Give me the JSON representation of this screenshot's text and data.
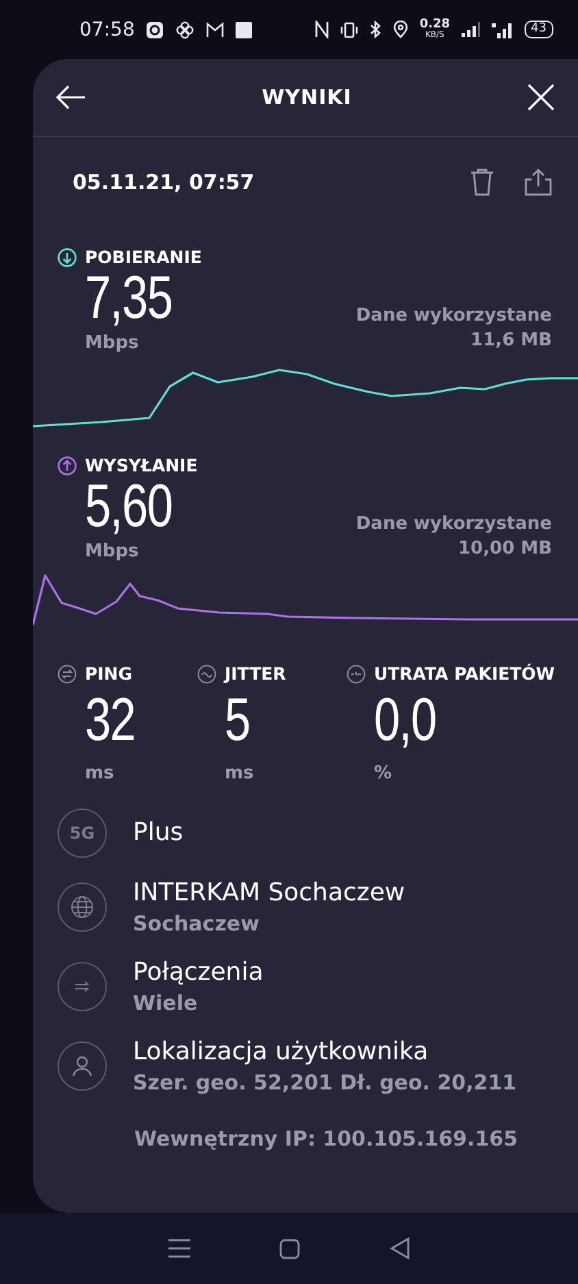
{
  "status_bar": {
    "time": "07:58",
    "network_speed": "0.28",
    "network_speed_unit": "KB/S",
    "battery": "43"
  },
  "header": {
    "title": "WYNIKI"
  },
  "result": {
    "date": "05.11.21, 07:57"
  },
  "speeds": [
    {
      "kind": "download",
      "label": "POBIERANIE",
      "value": "7,35",
      "unit": "Mbps",
      "data_label": "Dane wykorzystane",
      "data_value": "11,6 MB",
      "color": "#5ee0d8"
    },
    {
      "kind": "upload",
      "label": "WYSYŁANIE",
      "value": "5,60",
      "unit": "Mbps",
      "data_label": "Dane wykorzystane",
      "data_value": "10,00 MB",
      "color": "#b070e8"
    }
  ],
  "metrics": [
    {
      "kind": "ping",
      "label": "PING",
      "value": "32",
      "unit": "ms"
    },
    {
      "kind": "jitter",
      "label": "JITTER",
      "value": "5",
      "unit": "ms"
    },
    {
      "kind": "loss",
      "label": "UTRATA PAKIETÓW",
      "value": "0,0",
      "unit": "%"
    }
  ],
  "details": [
    {
      "kind": "network",
      "badge": "5G",
      "title": "Plus"
    },
    {
      "kind": "server",
      "title": "INTERKAM Sochaczew",
      "subtitle": "Sochaczew"
    },
    {
      "kind": "connections",
      "title": "Połączenia",
      "subtitle": "Wiele"
    },
    {
      "kind": "location",
      "title": "Lokalizacja użytkownika",
      "subtitle": "Szer. geo. 52,201 Dł. geo. 20,211"
    }
  ],
  "internal_ip": "Wewnętrzny IP: 100.105.169.165"
}
